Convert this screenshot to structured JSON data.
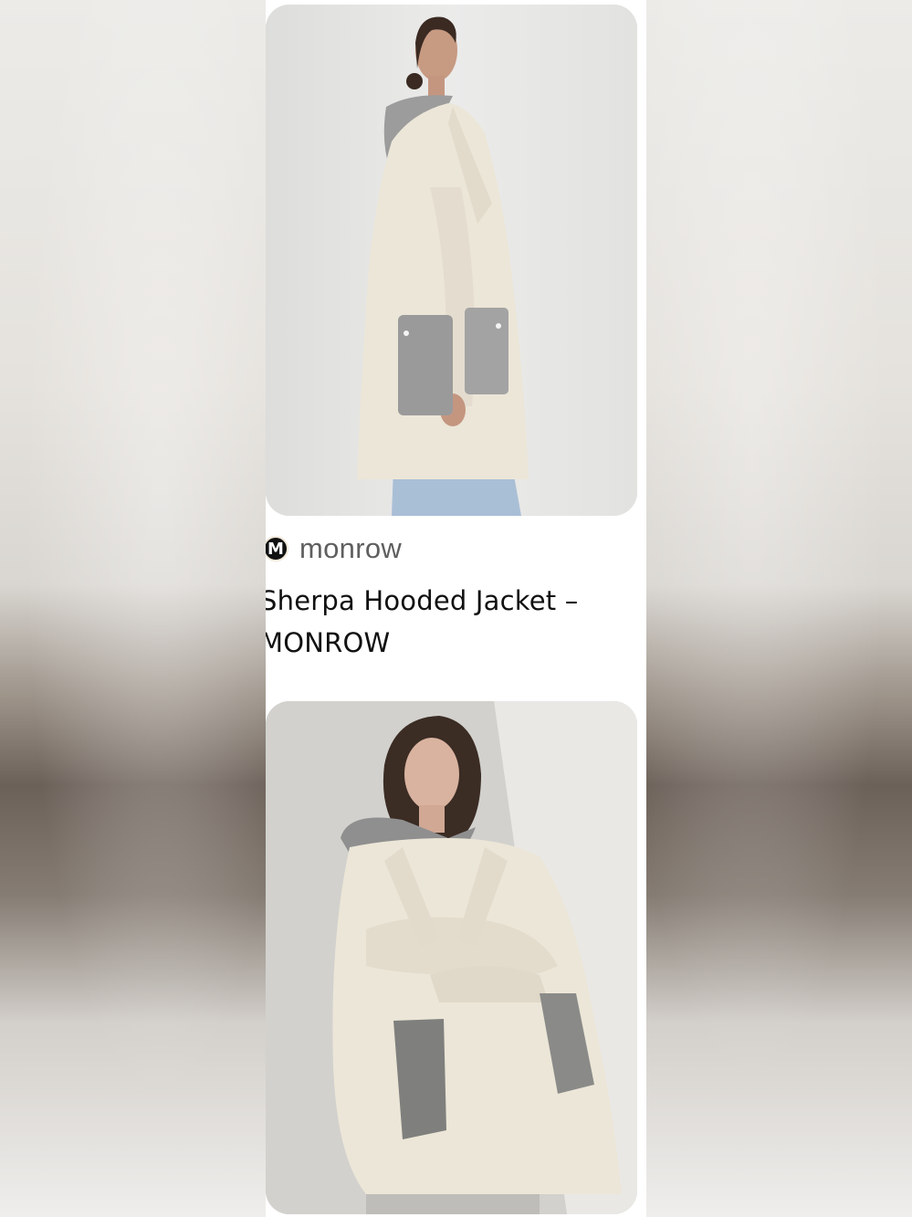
{
  "feed": {
    "pins": [
      {
        "image_alt": "Model in cream sherpa coat with grey hood and grey pockets, side view",
        "source": {
          "avatar_letter": "M",
          "name": "monrow"
        },
        "title": "Sherpa Hooded Jacket – MONROW"
      },
      {
        "image_alt": "Model leaning against wall wearing cream sherpa coat with grey hood"
      }
    ]
  },
  "colors": {
    "coat_cream": "#ece6d8",
    "hood_grey": "#9a9a9a",
    "background_wall": "#e6e6e4",
    "title_text": "#111111",
    "source_text": "#5f5f5f"
  }
}
